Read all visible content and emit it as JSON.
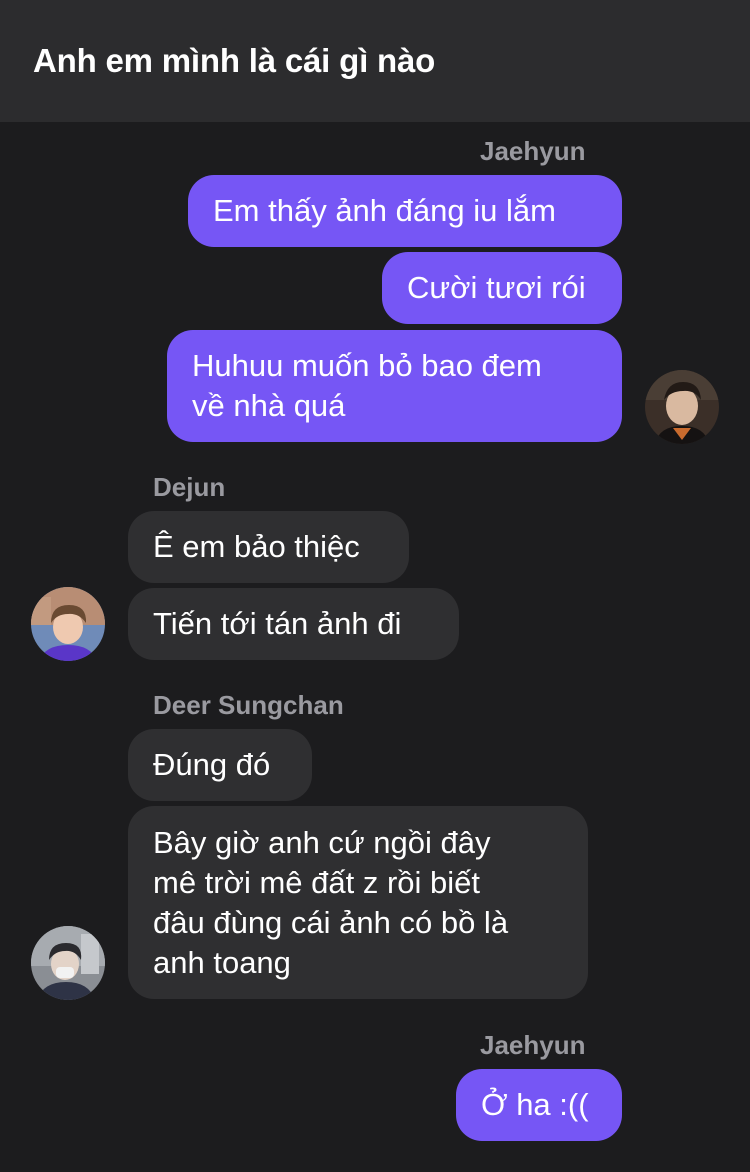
{
  "header": {
    "title": "Anh em mình là cái gì nào"
  },
  "messages": {
    "group1": {
      "sender": "Jaehyun",
      "lines": [
        "Em thấy ảnh đáng iu lắm",
        "Cười tươi rói",
        "Huhuu muốn bỏ bao đem",
        "về nhà quá"
      ]
    },
    "group2": {
      "sender": "Dejun",
      "lines": [
        "Ê em bảo thiệc",
        "Tiến tới tán ảnh đi"
      ]
    },
    "group3": {
      "sender": "Deer Sungchan",
      "lines": [
        "Đúng đó",
        "Bây giờ anh cứ ngồi đây",
        "mê trời mê đất z rồi biết",
        "đâu đùng cái ảnh có bồ là",
        "anh toang"
      ]
    },
    "group4": {
      "sender": "Jaehyun",
      "lines": [
        "Ở ha :(("
      ]
    }
  },
  "colors": {
    "background": "#1c1c1e",
    "header": "#2c2c2e",
    "outgoing_bubble": "#7656f5",
    "incoming_bubble": "#2f2f31",
    "sender_name": "#9a9aa0"
  },
  "icons": [
    "avatar-jaehyun",
    "avatar-dejun",
    "avatar-sungchan"
  ]
}
